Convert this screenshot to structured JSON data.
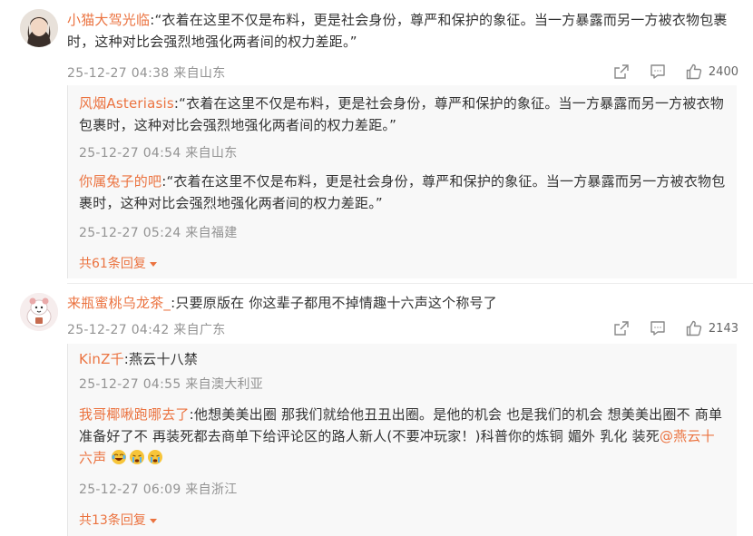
{
  "comments": [
    {
      "username": "小猫大驾光临",
      "text": ":“衣着在这里不仅是布料，更是社会身份，尊严和保护的象征。当一方暴露而另一方被衣物包裹时，这种对比会强烈地强化两者间的权力差距。”",
      "meta": "25-12-27 04:38 来自山东",
      "likes": "2400",
      "replies": [
        {
          "username": "风烟Asteriasis",
          "text": ":“衣着在这里不仅是布料，更是社会身份，尊严和保护的象征。当一方暴露而另一方被衣物包裹时，这种对比会强烈地强化两者间的权力差距。”",
          "meta": "25-12-27 04:54 来自山东"
        },
        {
          "username": "你属兔子的吧",
          "text": ":“衣着在这里不仅是布料，更是社会身份，尊严和保护的象征。当一方暴露而另一方被衣物包裹时，这种对比会强烈地强化两者间的权力差距。”",
          "meta": "25-12-27 05:24 来自福建"
        }
      ],
      "more_replies": "共61条回复"
    },
    {
      "username": "来瓶蜜桃乌龙茶_",
      "text": ":只要原版在 你这辈子都甩不掉情趣十六声这个称号了",
      "meta": "25-12-27 04:42 来自广东",
      "likes": "2143",
      "replies": [
        {
          "username": "KinZ千",
          "text": ":燕云十八禁",
          "meta": "25-12-27 04:55 来自澳大利亚"
        },
        {
          "username": "我哥椰啾跑哪去了",
          "text": ":他想美美出圈 那我们就给他丑丑出圈。是他的机会 也是我们的机会 想美美出圈不 商单准备好了不 再装死都去商单下给评论区的路人新人(不要冲玩家！)科普你的炼铜 媚外 乳化 装死",
          "mention": "@燕云十六声",
          "emojis": [
            "laugh-cry-emoji",
            "cry-emoji",
            "cry-emoji"
          ],
          "meta": "25-12-27 06:09 来自浙江"
        }
      ],
      "more_replies": "共13条回复"
    }
  ],
  "icons": {
    "share": "share-icon",
    "comment": "comment-icon",
    "like": "thumb-up-icon"
  },
  "colors": {
    "username": "#eb7340",
    "meta": "#939393",
    "reply_background": "#f8f8f8"
  }
}
